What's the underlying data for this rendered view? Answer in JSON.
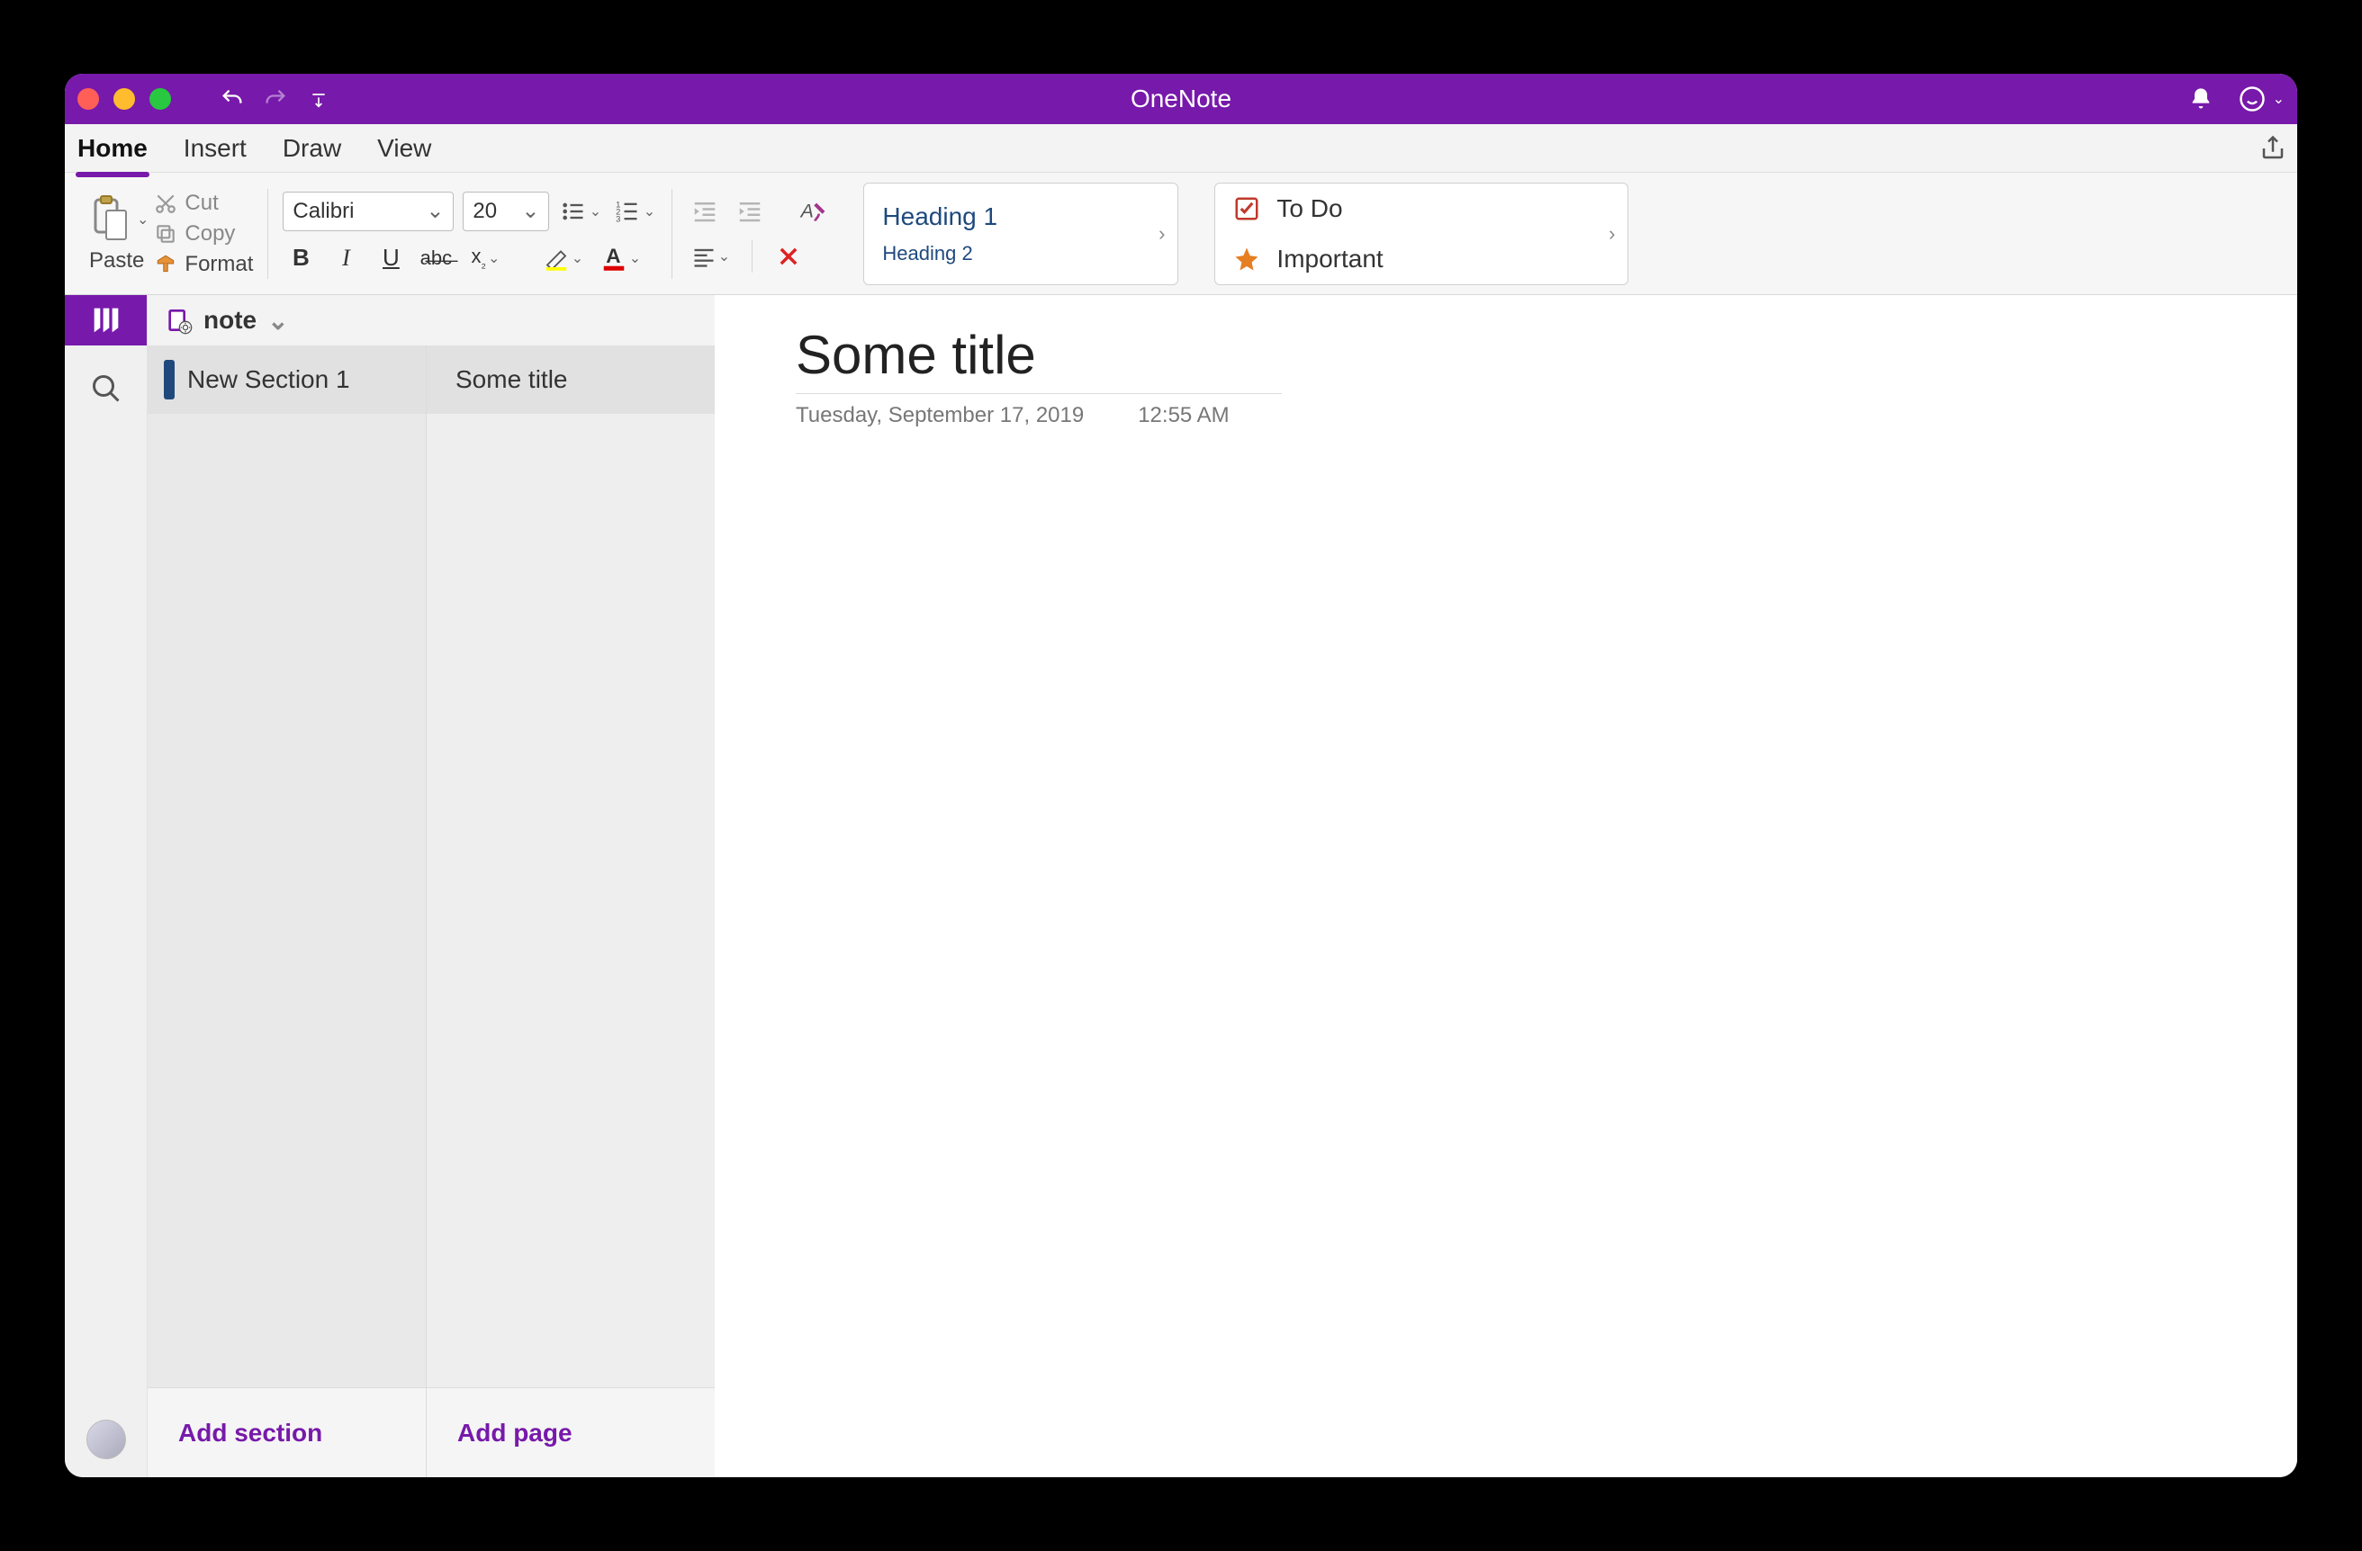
{
  "app_title": "OneNote",
  "menu": {
    "tabs": [
      "Home",
      "Insert",
      "Draw",
      "View"
    ],
    "active": "Home"
  },
  "ribbon": {
    "paste_label": "Paste",
    "cut_label": "Cut",
    "copy_label": "Copy",
    "format_label": "Format",
    "font_name": "Calibri",
    "font_size": "20",
    "styles": {
      "heading1": "Heading 1",
      "heading2": "Heading 2"
    },
    "tags": {
      "todo": "To Do",
      "important": "Important"
    }
  },
  "notebook": {
    "name": "note",
    "sections": [
      {
        "name": "New Section 1"
      }
    ],
    "pages": [
      {
        "title": "Some title"
      }
    ],
    "add_section_label": "Add section",
    "add_page_label": "Add page"
  },
  "page": {
    "title": "Some title",
    "date": "Tuesday, September 17, 2019",
    "time": "12:55 AM"
  }
}
